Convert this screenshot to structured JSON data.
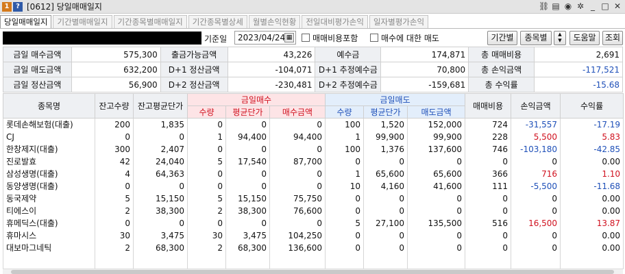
{
  "window": {
    "badge1": "1",
    "badge2": "?",
    "title": "[0612] 당일매매일지",
    "icons": [
      "link-icon",
      "copy-icon",
      "camera-icon",
      "settings-icon",
      "minimize-icon",
      "maximize-icon",
      "close-icon"
    ],
    "icon_glyphs": [
      "⛓",
      "▤",
      "◉",
      "✲",
      "_",
      "□",
      "✕"
    ]
  },
  "tabs": [
    {
      "label": "당일매매일지",
      "active": true
    },
    {
      "label": "기간별매매일지",
      "active": false
    },
    {
      "label": "기간종목별매매일지",
      "active": false
    },
    {
      "label": "기간종목별상세",
      "active": false
    },
    {
      "label": "월별손익현황",
      "active": false
    },
    {
      "label": "전일대비평가손익",
      "active": false
    },
    {
      "label": "일자별평가손익",
      "active": false
    }
  ],
  "toolbar": {
    "base_label": "기준일",
    "date_value": "2023/04/24",
    "cal_glyph": "▦",
    "fee_checkbox_label": "매매비용포함",
    "buy_sell_checkbox_label": "매수에 대한 매도",
    "period_button": "기간별",
    "stock_button": "종목별",
    "spin_up": "▲",
    "spin_down": "▼",
    "help_button": "도움말",
    "query_button": "조회"
  },
  "summary": [
    [
      "금일 매수금액",
      "575,300",
      "출금가능금액",
      "43,226",
      "예수금",
      "174,871",
      "총 매매비용",
      "2,691"
    ],
    [
      "금일 매도금액",
      "632,200",
      "D+1 정산금액",
      "-104,071",
      "D+1 추정예수금",
      "70,800",
      "총 손익금액",
      "-117,521"
    ],
    [
      "금일 정산금액",
      "56,900",
      "D+2 정산금액",
      "-230,481",
      "D+2 추정예수금",
      "-159,681",
      "총 수익률",
      "-15.68"
    ]
  ],
  "grid": {
    "headers": {
      "name": "종목명",
      "qty": "잔고수량",
      "avg": "잔고평균단가",
      "buy_group": "금일매수",
      "buy_qty": "수량",
      "buy_avg": "평균단가",
      "buy_amt": "매수금액",
      "sell_group": "금일매도",
      "sell_qty": "수량",
      "sell_avg": "평균단가",
      "sell_amt": "매도금액",
      "fee": "매매비용",
      "pnl": "손익금액",
      "rate": "수익률"
    },
    "rows": [
      {
        "name": "롯데손해보험(대출)",
        "qty": "200",
        "avg": "1,835",
        "bq": "0",
        "bavg": "0",
        "bamt": "0",
        "sq": "100",
        "savg": "1,520",
        "samt": "152,000",
        "fee": "724",
        "pnl": "-31,557",
        "rate": "-17.19",
        "sign": "neg"
      },
      {
        "name": "CJ",
        "qty": "0",
        "avg": "0",
        "bq": "1",
        "bavg": "94,400",
        "bamt": "94,400",
        "sq": "1",
        "savg": "99,900",
        "samt": "99,900",
        "fee": "228",
        "pnl": "5,500",
        "rate": "5.83",
        "sign": "pos"
      },
      {
        "name": "한창제지(대출)",
        "qty": "300",
        "avg": "2,407",
        "bq": "0",
        "bavg": "0",
        "bamt": "0",
        "sq": "100",
        "savg": "1,376",
        "samt": "137,600",
        "fee": "746",
        "pnl": "-103,180",
        "rate": "-42.85",
        "sign": "neg"
      },
      {
        "name": "진로발효",
        "qty": "42",
        "avg": "24,040",
        "bq": "5",
        "bavg": "17,540",
        "bamt": "87,700",
        "sq": "0",
        "savg": "0",
        "samt": "0",
        "fee": "0",
        "pnl": "0",
        "rate": "0.00",
        "sign": "zero"
      },
      {
        "name": "삼성생명(대출)",
        "qty": "4",
        "avg": "64,363",
        "bq": "0",
        "bavg": "0",
        "bamt": "0",
        "sq": "1",
        "savg": "65,600",
        "samt": "65,600",
        "fee": "366",
        "pnl": "716",
        "rate": "1.10",
        "sign": "pos"
      },
      {
        "name": "동양생명(대출)",
        "qty": "0",
        "avg": "0",
        "bq": "0",
        "bavg": "0",
        "bamt": "0",
        "sq": "10",
        "savg": "4,160",
        "samt": "41,600",
        "fee": "111",
        "pnl": "-5,500",
        "rate": "-11.68",
        "sign": "neg"
      },
      {
        "name": "동국제약",
        "qty": "5",
        "avg": "15,150",
        "bq": "5",
        "bavg": "15,150",
        "bamt": "75,750",
        "sq": "0",
        "savg": "0",
        "samt": "0",
        "fee": "0",
        "pnl": "0",
        "rate": "0.00",
        "sign": "zero"
      },
      {
        "name": "티에스이",
        "qty": "2",
        "avg": "38,300",
        "bq": "2",
        "bavg": "38,300",
        "bamt": "76,600",
        "sq": "0",
        "savg": "0",
        "samt": "0",
        "fee": "0",
        "pnl": "0",
        "rate": "0.00",
        "sign": "zero"
      },
      {
        "name": "휴메딕스(대출)",
        "qty": "0",
        "avg": "0",
        "bq": "0",
        "bavg": "0",
        "bamt": "0",
        "sq": "5",
        "savg": "27,100",
        "samt": "135,500",
        "fee": "516",
        "pnl": "16,500",
        "rate": "13.87",
        "sign": "pos"
      },
      {
        "name": "휴마시스",
        "qty": "30",
        "avg": "3,475",
        "bq": "30",
        "bavg": "3,475",
        "bamt": "104,250",
        "sq": "0",
        "savg": "0",
        "samt": "0",
        "fee": "0",
        "pnl": "0",
        "rate": "0.00",
        "sign": "zero"
      },
      {
        "name": "대보마그네틱",
        "qty": "2",
        "avg": "68,300",
        "bq": "2",
        "bavg": "68,300",
        "bamt": "136,600",
        "sq": "0",
        "savg": "0",
        "samt": "0",
        "fee": "0",
        "pnl": "0",
        "rate": "0.00",
        "sign": "zero"
      }
    ]
  },
  "colors": {
    "negative": "#1e4fb8",
    "positive": "#d0101e"
  }
}
